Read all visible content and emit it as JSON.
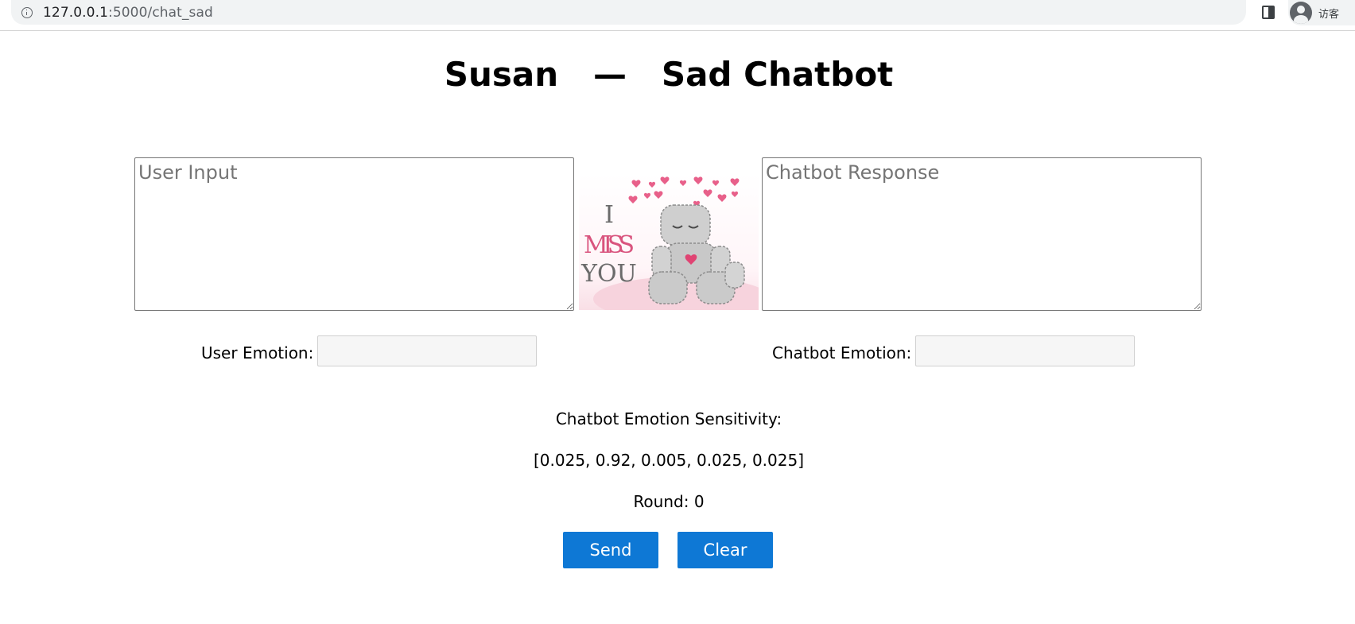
{
  "browser": {
    "url_host": "127.0.0.1",
    "url_path": ":5000/chat_sad",
    "profile_label": "访客"
  },
  "page": {
    "title": "Susan   —   Sad Chatbot",
    "user_input_placeholder": "User Input",
    "bot_response_placeholder": "Chatbot Response",
    "image_text": [
      "I",
      "MISS",
      "YOU"
    ],
    "user_emotion_label": "User Emotion:",
    "bot_emotion_label": "Chatbot Emotion:",
    "user_emotion_value": "",
    "bot_emotion_value": "",
    "sensitivity_label": "Chatbot Emotion Sensitivity:",
    "sensitivity_values": "[0.025, 0.92, 0.005, 0.025, 0.025]",
    "round_text": "Round: 0",
    "send_label": "Send",
    "clear_label": "Clear"
  },
  "colors": {
    "button": "#0e78d5",
    "heart": "#e8608a",
    "robot": "#c9c9c9"
  },
  "icons": [
    "info-icon",
    "side-panel-icon",
    "avatar-icon",
    "heart-icon"
  ]
}
